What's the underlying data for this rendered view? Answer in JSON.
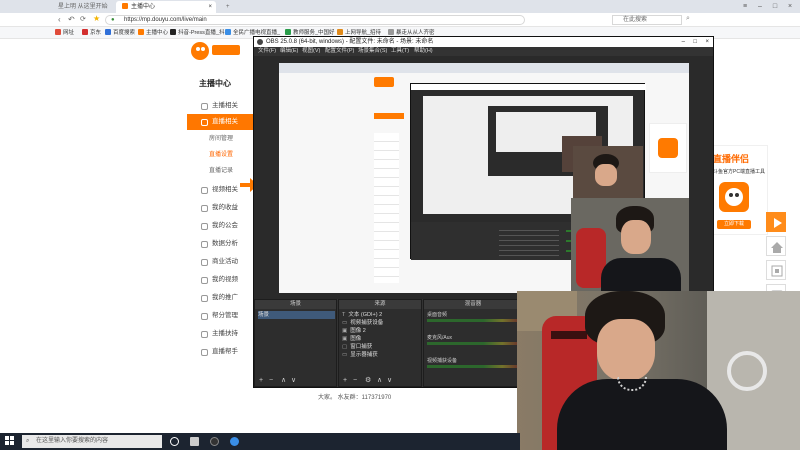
{
  "browser": {
    "tabs": [
      {
        "label": "星上明 从这里开始"
      },
      {
        "label": "主播中心"
      }
    ],
    "address": "https://mp.douyu.com/live/main",
    "search_placeholder": "在此搜索",
    "bookmarks": [
      {
        "label": "网址",
        "color": "#e04b3a"
      },
      {
        "label": "京东",
        "color": "#d32f2f"
      },
      {
        "label": "百度搜索",
        "color": "#2f6fd8"
      },
      {
        "label": "主播中心",
        "color": "#ff7a00"
      },
      {
        "label": "抖音-Press直播_抖",
        "color": "#222222"
      },
      {
        "label": "全民广播电视直播_",
        "color": "#3a8ee6"
      },
      {
        "label": "教师服务_中国好",
        "color": "#2a9d4b"
      },
      {
        "label": "上网导航_招待",
        "color": "#e08a1a"
      },
      {
        "label": "暴走从从人齐密",
        "color": "#999999"
      }
    ]
  },
  "page": {
    "sidebar_title": "主播中心",
    "nav": [
      {
        "label": "主播相关",
        "type": "item",
        "icon": "user-icon"
      },
      {
        "label": "直播相关",
        "type": "active",
        "icon": "video-icon"
      },
      {
        "label": "房间管理",
        "type": "sub"
      },
      {
        "label": "直播设置",
        "type": "sub-on"
      },
      {
        "label": "直播记录",
        "type": "sub"
      },
      {
        "label": "视频相关",
        "type": "item",
        "icon": "film-icon"
      },
      {
        "label": "我的收益",
        "type": "item",
        "icon": "coin-icon"
      },
      {
        "label": "我的公会",
        "type": "item",
        "icon": "group-icon"
      },
      {
        "label": "数据分析",
        "type": "item",
        "icon": "chart-icon"
      },
      {
        "label": "商业活动",
        "type": "item",
        "icon": "bag-icon"
      },
      {
        "label": "我的视频",
        "type": "item",
        "icon": "play-icon"
      },
      {
        "label": "我的推广",
        "type": "item",
        "icon": "megaphone-icon"
      },
      {
        "label": "帮分管理",
        "type": "item",
        "icon": "gear-icon"
      },
      {
        "label": "主播扶持",
        "type": "item",
        "icon": "hand-icon"
      },
      {
        "label": "直播帮手",
        "type": "item",
        "icon": "help-icon"
      }
    ],
    "footer_text": "大家。 水友群：117371970",
    "promo": {
      "title": "直播伴侣",
      "subtitle": "斗鱼官方PC端直播工具",
      "button": "立即下载"
    }
  },
  "obs": {
    "title": "OBS 25.0.8 (64-bit, windows) - 配置文件: 未命名 - 场景: 未命名",
    "menu": [
      "文件(F)",
      "编辑(E)",
      "视图(V)",
      "配置文件(P)",
      "场景集合(S)",
      "工具(T)",
      "帮助(H)"
    ],
    "scenes_header": "场景",
    "scenes": [
      "场景"
    ],
    "sources_header": "来源",
    "sources": [
      "文本 (GDI+) 2",
      "视频捕获设备",
      "图像 2",
      "图像",
      "窗口捕获",
      "显示器捕获"
    ],
    "mixer_header": "混音器",
    "mixer": [
      "桌面音频",
      "麦克风/Aux",
      "视频捕获设备"
    ]
  },
  "taskbar": {
    "search_placeholder": "在这里输入你要搜索的内容"
  }
}
